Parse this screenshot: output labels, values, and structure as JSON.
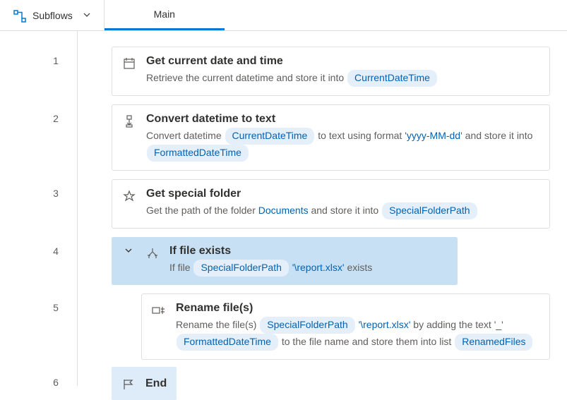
{
  "toolbar": {
    "subflows_label": "Subflows"
  },
  "tabs": [
    {
      "label": "Main",
      "active": true
    }
  ],
  "steps": [
    {
      "n": "1",
      "icon": "calendar",
      "title": "Get current date and time",
      "desc_pre": "Retrieve the current datetime and store it into ",
      "var1": "CurrentDateTime"
    },
    {
      "n": "2",
      "icon": "convert",
      "title": "Convert datetime to text",
      "d1": "Convert datetime ",
      "v1": "CurrentDateTime",
      "d2": " to text using format '",
      "lit": "yyyy-MM-dd",
      "d3": "' and store it into ",
      "v2": "FormattedDateTime"
    },
    {
      "n": "3",
      "icon": "star",
      "title": "Get special folder",
      "d1": "Get the path of the folder ",
      "link": "Documents",
      "d2": " and store it into ",
      "v1": "SpecialFolderPath"
    },
    {
      "n": "4",
      "icon": "branch",
      "title": "If file exists",
      "d1": "If file ",
      "v1": "SpecialFolderPath",
      "lit": "'\\report.xlsx'",
      "d2": " exists"
    },
    {
      "n": "5",
      "icon": "rename",
      "title": "Rename file(s)",
      "d1": "Rename the file(s) ",
      "v1": "SpecialFolderPath",
      "lit1": "'\\report.xlsx'",
      "d2": " by adding the text '",
      "lit2": "_",
      "d3": "'",
      "v2": "FormattedDateTime",
      "d4": " to the file name and store them into list",
      "v3": "RenamedFiles"
    },
    {
      "n": "6",
      "icon": "flag",
      "title": "End"
    }
  ]
}
